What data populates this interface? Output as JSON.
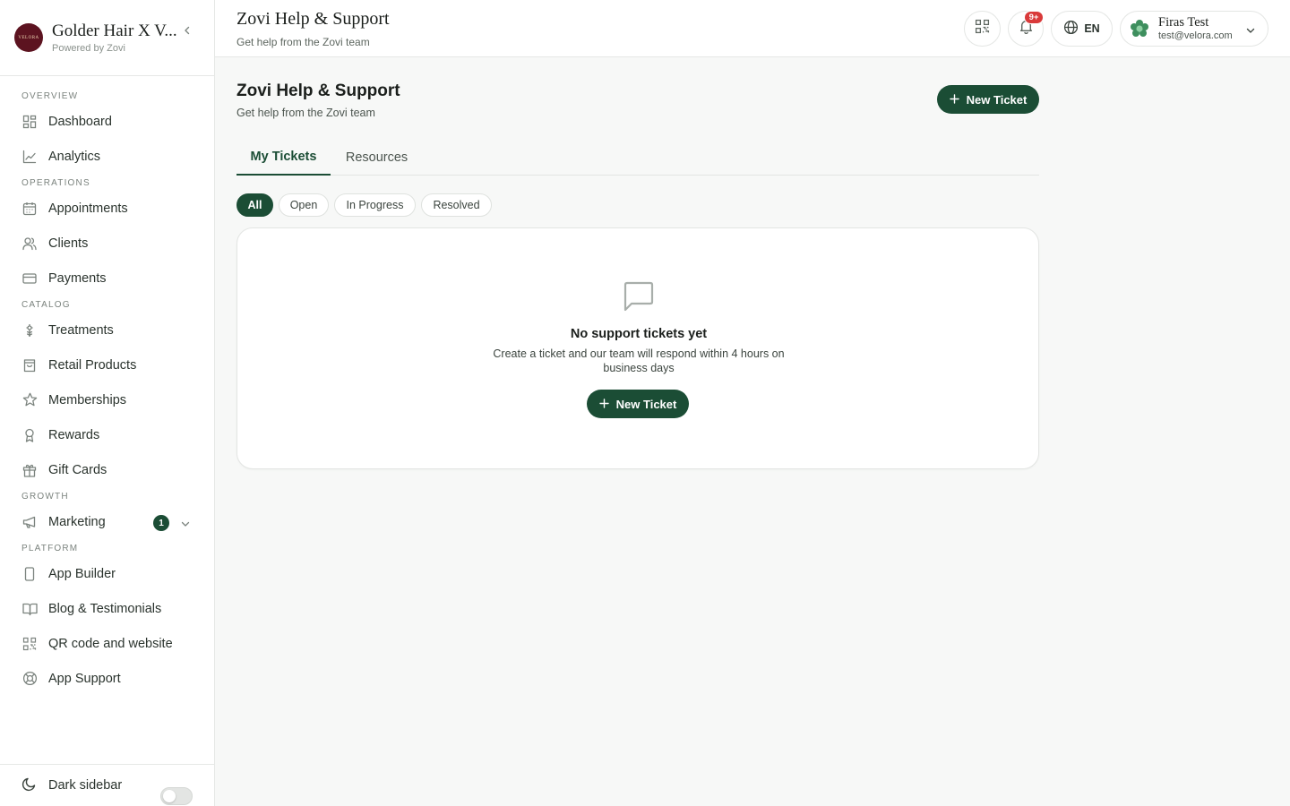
{
  "brand": {
    "name": "Golder Hair X V...",
    "subtitle": "Powered by Zovi",
    "logo_text": "VELORA"
  },
  "sidebar": {
    "sections": {
      "overview": "OVERVIEW",
      "operations": "OPERATIONS",
      "catalog": "CATALOG",
      "growth": "GROWTH",
      "platform": "PLATFORM"
    },
    "items": {
      "dashboard": "Dashboard",
      "analytics": "Analytics",
      "appointments": "Appointments",
      "clients": "Clients",
      "payments": "Payments",
      "treatments": "Treatments",
      "retail_products": "Retail Products",
      "memberships": "Memberships",
      "rewards": "Rewards",
      "gift_cards": "Gift Cards",
      "marketing": "Marketing",
      "marketing_badge": "1",
      "app_builder": "App Builder",
      "blog": "Blog & Testimonials",
      "qr_website": "QR code and website",
      "app_support": "App Support"
    },
    "footer": {
      "dark_sidebar": "Dark sidebar",
      "dark_sidebar_on": false
    }
  },
  "header": {
    "title": "Zovi Help & Support",
    "subtitle": "Get help from the Zovi team",
    "notifications_badge": "9+",
    "language": "EN",
    "user": {
      "name": "Firas Test",
      "email": "test@velora.com"
    }
  },
  "main": {
    "title": "Zovi Help & Support",
    "subtitle": "Get help from the Zovi team",
    "new_ticket_label": "New Ticket",
    "tabs": [
      "My Tickets",
      "Resources"
    ],
    "active_tab": "My Tickets",
    "filters": [
      "All",
      "Open",
      "In Progress",
      "Resolved"
    ],
    "active_filter": "All",
    "empty_state": {
      "title": "No support tickets yet",
      "description": "Create a ticket and our team will respond within 4 hours on business days",
      "button_label": "New Ticket"
    }
  },
  "colors": {
    "accent": "#1b4d35",
    "badge_red": "#d93a3a",
    "brand_logo": "#5c1320"
  }
}
